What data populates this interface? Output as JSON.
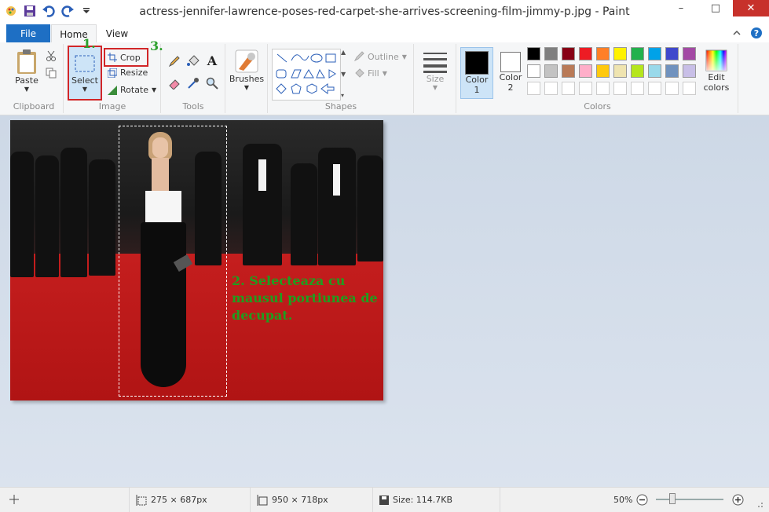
{
  "window": {
    "title": "actress-jennifer-lawrence-poses-red-carpet-she-arrives-screening-film-jimmy-p.jpg - Paint",
    "minimize": "–",
    "maximize": "□",
    "close": "✕"
  },
  "tabs": {
    "file": "File",
    "home": "Home",
    "view": "View"
  },
  "ribbon": {
    "clipboard": {
      "label": "Clipboard",
      "paste": "Paste"
    },
    "image": {
      "label": "Image",
      "select": "Select",
      "crop": "Crop",
      "resize": "Resize",
      "rotate": "Rotate"
    },
    "tools": {
      "label": "Tools"
    },
    "brushes": {
      "label": "Brushes"
    },
    "shapes": {
      "label": "Shapes",
      "outline": "Outline",
      "fill": "Fill"
    },
    "size": {
      "label": "Size"
    },
    "colors": {
      "label": "Colors",
      "color1": "Color",
      "color1_num": "1",
      "color2": "Color",
      "color2_num": "2",
      "edit": "Edit",
      "edit2": "colors",
      "palette": [
        "#000000",
        "#7f7f7f",
        "#880015",
        "#ed1c24",
        "#ff7f27",
        "#fff200",
        "#22b14c",
        "#00a2e8",
        "#3f48cc",
        "#a349a4",
        "#ffffff",
        "#c3c3c3",
        "#b97a57",
        "#ffaec9",
        "#ffc90e",
        "#efe4b0",
        "#b5e61d",
        "#99d9ea",
        "#7092be",
        "#c8bfe7",
        "#ffffff",
        "#ffffff",
        "#ffffff",
        "#ffffff",
        "#ffffff",
        "#ffffff",
        "#ffffff",
        "#ffffff",
        "#ffffff",
        "#ffffff"
      ]
    }
  },
  "annotations": {
    "step1": "1.",
    "step3": "3.",
    "step2_text": "2. Selecteaza cu mausul portiunea de decupat."
  },
  "status": {
    "selection_size": "275 × 687px",
    "image_size": "950 × 718px",
    "file_size": "Size: 114.7KB",
    "zoom": "50%"
  }
}
